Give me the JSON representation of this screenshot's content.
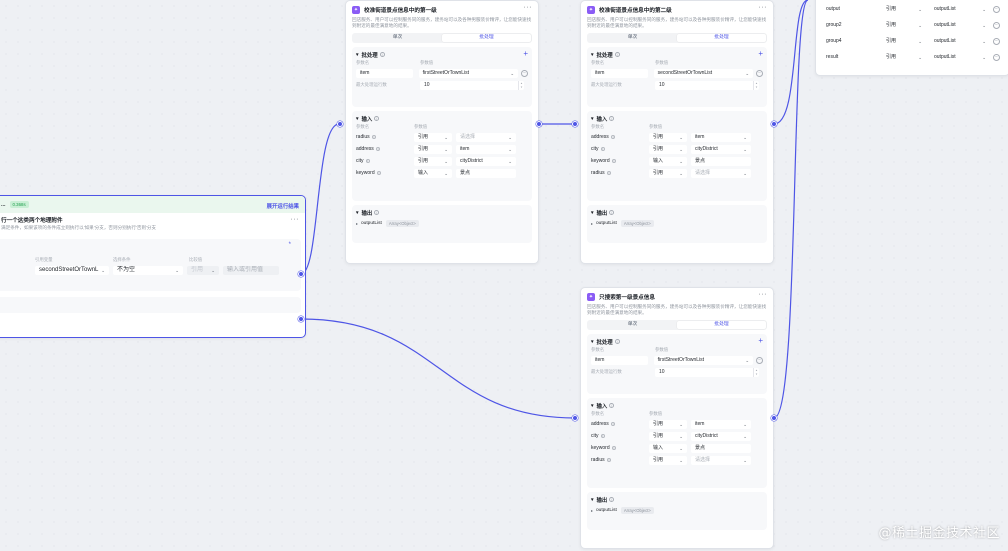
{
  "left_node": {
    "title": "...",
    "badge": "0.368s",
    "run_link": "展开运行结果",
    "desc_line1": "行一个这类两个地理附件",
    "desc_line2": "满足条件，如果该项的条件成立则执行以'如果'分支，否则分别执行'否则'分支",
    "col_label": "引用变量",
    "col_cond": "选择条件",
    "col_compare": "比较值",
    "ref_value": "secondStreetOrTownL",
    "cond_value": "不为空",
    "compare_type": "引用",
    "compare_placeholder": "输入或引用值"
  },
  "node1": {
    "title": "校准街道景点信息中的第一级",
    "desc": "回店服务、用户可以控制服务同的服务，建务站可以及各种男服装价精评，让您能快速找到附近的最佳满意地的结果。",
    "tabs": [
      "单次",
      "批处理"
    ],
    "batch": {
      "title": "批处理",
      "col_name": "参数名",
      "col_value": "参数值",
      "item_name": "item",
      "item_value": "firstStreetOrTownList",
      "concurrency_label": "最大处理运行数",
      "concurrency_value": "10"
    },
    "input": {
      "title": "输入",
      "col_name": "参数名",
      "col_value": "参数值",
      "rows": [
        {
          "name": "radius",
          "type": "引用",
          "value": "请选择",
          "placeholder": true
        },
        {
          "name": "address",
          "type": "引用",
          "value": "item",
          "placeholder": false
        },
        {
          "name": "city",
          "type": "引用",
          "value": "cityDistrict",
          "placeholder": false
        },
        {
          "name": "keyword",
          "type": "输入",
          "value": "景点",
          "placeholder": false
        }
      ]
    },
    "output": {
      "title": "输出",
      "name": "outputList",
      "type": "Array<Object>"
    }
  },
  "node2": {
    "title": "校准街道景点信息中的第二级",
    "desc": "回店服务、用户可以控制服务同的服务，建务站可以及各种男服装价精评，让您能快速找到附近的最佳满意地的结果。",
    "tabs": [
      "单次",
      "批处理"
    ],
    "batch": {
      "title": "批处理",
      "col_name": "参数名",
      "col_value": "参数值",
      "item_name": "item",
      "item_value": "secondStreetOrTownList",
      "concurrency_label": "最大处理运行数",
      "concurrency_value": "10"
    },
    "input": {
      "title": "输入",
      "col_name": "参数名",
      "col_value": "参数值",
      "rows": [
        {
          "name": "address",
          "type": "引用",
          "value": "item",
          "placeholder": false
        },
        {
          "name": "city",
          "type": "引用",
          "value": "cityDistrict",
          "placeholder": false
        },
        {
          "name": "keyword",
          "type": "输入",
          "value": "景点",
          "placeholder": false
        },
        {
          "name": "radius",
          "type": "引用",
          "value": "请选择",
          "placeholder": true
        }
      ]
    },
    "output": {
      "title": "输出",
      "name": "outputList",
      "type": "Array<Object>"
    }
  },
  "node3": {
    "title": "只搜索第一级景点信息",
    "desc": "回店服务、用户可以控制服务同的服务，建务站可以及各种男服装价精评，让您能快速找到附近的最佳满意地的结果。",
    "tabs": [
      "单次",
      "批处理"
    ],
    "batch": {
      "title": "批处理",
      "col_name": "参数名",
      "col_value": "参数值",
      "item_name": "item",
      "item_value": "firstStreetOrTownList",
      "concurrency_label": "最大处理运行数",
      "concurrency_value": "10"
    },
    "input": {
      "title": "输入",
      "col_name": "参数名",
      "col_value": "参数值",
      "rows": [
        {
          "name": "address",
          "type": "引用",
          "value": "item",
          "placeholder": false
        },
        {
          "name": "city",
          "type": "引用",
          "value": "cityDistrict",
          "placeholder": false
        },
        {
          "name": "keyword",
          "type": "输入",
          "value": "景点",
          "placeholder": false
        },
        {
          "name": "radius",
          "type": "引用",
          "value": "请选择",
          "placeholder": true
        }
      ]
    },
    "output": {
      "title": "输出",
      "name": "outputList",
      "type": "Array<Object>"
    }
  },
  "right_node": {
    "rows": [
      {
        "name": "output",
        "type": "引用",
        "value": "outputList"
      },
      {
        "name": "group2",
        "type": "引用",
        "value": "outputList"
      },
      {
        "name": "group4",
        "type": "引用",
        "value": "outputList"
      },
      {
        "name": "result",
        "type": "引用",
        "value": "outputList"
      }
    ]
  },
  "watermark": "@稀土掘金技术社区",
  "colors": {
    "accent": "#4e55e6",
    "node_icon": "#8a5cf5",
    "run_header": "#eaf7ee"
  }
}
